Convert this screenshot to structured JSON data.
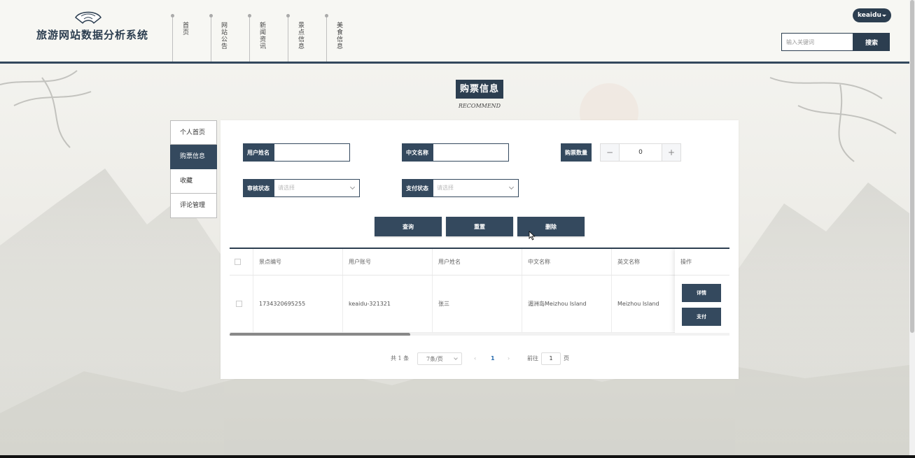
{
  "header": {
    "site_title": "旅游网站数据分析系统",
    "nav": [
      {
        "label": "首页"
      },
      {
        "label": "网站公告"
      },
      {
        "label": "新闻资讯"
      },
      {
        "label": "景点信息"
      },
      {
        "label": "美食信息"
      }
    ],
    "user_name": "keaidu",
    "search_placeholder": "输入关键词",
    "search_button": "搜索"
  },
  "page": {
    "title": "购票信息",
    "subtitle": "RECOMMEND"
  },
  "side_menu": [
    {
      "label": "个人首页",
      "active": false
    },
    {
      "label": "购票信息",
      "active": true
    },
    {
      "label": "收藏",
      "active": false
    },
    {
      "label": "评论管理",
      "active": false
    }
  ],
  "filters": {
    "username_label": "用户姓名",
    "cn_name_label": "中文名称",
    "quantity_label": "购票数量",
    "quantity_value": "0",
    "quantity_minus": "−",
    "quantity_plus": "+",
    "review_label": "审核状态",
    "review_placeholder": "请选择",
    "pay_label": "支付状态",
    "pay_placeholder": "请选择"
  },
  "actions": {
    "query": "查询",
    "reset": "重置",
    "delete": "删除"
  },
  "table": {
    "columns": [
      "景点编号",
      "用户账号",
      "用户姓名",
      "中文名称",
      "英文名称"
    ],
    "op_header": "操作",
    "rows": [
      {
        "cells": [
          "1734320695255",
          "keaidu-321321",
          "张三",
          "湄洲岛Meizhou Island",
          "Meizhou Island"
        ],
        "detail": "详情",
        "pay": "支付"
      }
    ]
  },
  "pagination": {
    "total_prefix": "共",
    "total": "1",
    "total_suffix": "条",
    "page_size": "7条/页",
    "prev": "‹",
    "current": "1",
    "next": "›",
    "goto_prefix": "前往",
    "goto_value": "1",
    "goto_suffix": "页"
  },
  "colors": {
    "primary": "#34495e",
    "header_line": "#34495e",
    "link": "#2c6fb0"
  }
}
